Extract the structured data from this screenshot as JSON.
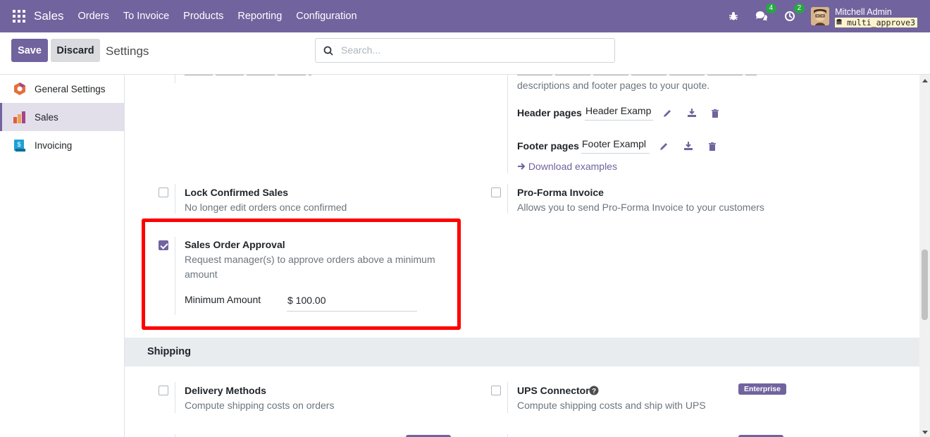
{
  "navbar": {
    "app_name": "Sales",
    "menu": [
      "Orders",
      "To Invoice",
      "Products",
      "Reporting",
      "Configuration"
    ],
    "chat_count": "4",
    "activity_count": "2",
    "user_name": "Mitchell Admin",
    "db_name": "multi_approve3"
  },
  "control_panel": {
    "save_label": "Save",
    "discard_label": "Discard",
    "title": "Settings",
    "search_placeholder": "Search..."
  },
  "sidebar": {
    "items": [
      {
        "label": "General Settings",
        "icon": "odoo-logo-icon"
      },
      {
        "label": "Sales",
        "icon": "sales-chart-icon",
        "active": true
      },
      {
        "label": "Invoicing",
        "icon": "invoicing-icon"
      }
    ]
  },
  "quotation_builder": {
    "desc_partial": "descriptions and footer pages to your quote.",
    "header_label": "Header pages",
    "header_value": "Header Examp",
    "footer_label": "Footer pages",
    "footer_value": "Footer Exampl",
    "download_link": "Download examples"
  },
  "lock_confirmed": {
    "title": "Lock Confirmed Sales",
    "desc": "No longer edit orders once confirmed",
    "checked": false
  },
  "pro_forma": {
    "title": "Pro-Forma Invoice",
    "desc": "Allows you to send Pro-Forma Invoice to your customers",
    "checked": false
  },
  "approval": {
    "title": "Sales Order Approval",
    "desc": "Request manager(s) to approve orders above a minimum amount",
    "checked": true,
    "min_label": "Minimum Amount",
    "min_value": "$ 100.00"
  },
  "shipping": {
    "section_title": "Shipping",
    "delivery_title": "Delivery Methods",
    "delivery_desc": "Compute shipping costs on orders",
    "ups_title": "UPS Connector",
    "ups_desc": "Compute shipping costs and ship with UPS",
    "enterprise_label": "Enterprise"
  },
  "colors": {
    "brand": "#71639e",
    "highlight": "#ff0000",
    "badge": "#28a745"
  }
}
